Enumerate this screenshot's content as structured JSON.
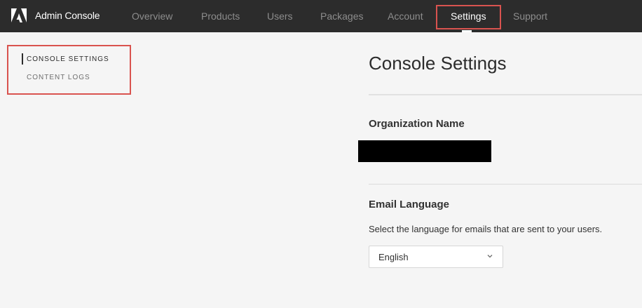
{
  "header": {
    "app_title": "Admin Console",
    "logo_icon": "adobe-logo",
    "nav": [
      {
        "label": "Overview"
      },
      {
        "label": "Products"
      },
      {
        "label": "Users"
      },
      {
        "label": "Packages"
      },
      {
        "label": "Account"
      },
      {
        "label": "Settings",
        "active": true
      },
      {
        "label": "Support"
      }
    ]
  },
  "sidebar": {
    "items": [
      {
        "label": "CONSOLE SETTINGS",
        "active": true
      },
      {
        "label": "CONTENT LOGS"
      }
    ]
  },
  "main": {
    "title": "Console Settings",
    "org_section": {
      "heading": "Organization Name"
    },
    "email_section": {
      "heading": "Email Language",
      "description": "Select the language for emails that are sent to your users.",
      "selected_language": "English",
      "dropdown_icon": "chevron-down-icon"
    }
  },
  "colors": {
    "topbar_bg": "#2c2c2c",
    "page_bg": "#f5f5f5",
    "highlight_box": "#d9534f"
  }
}
